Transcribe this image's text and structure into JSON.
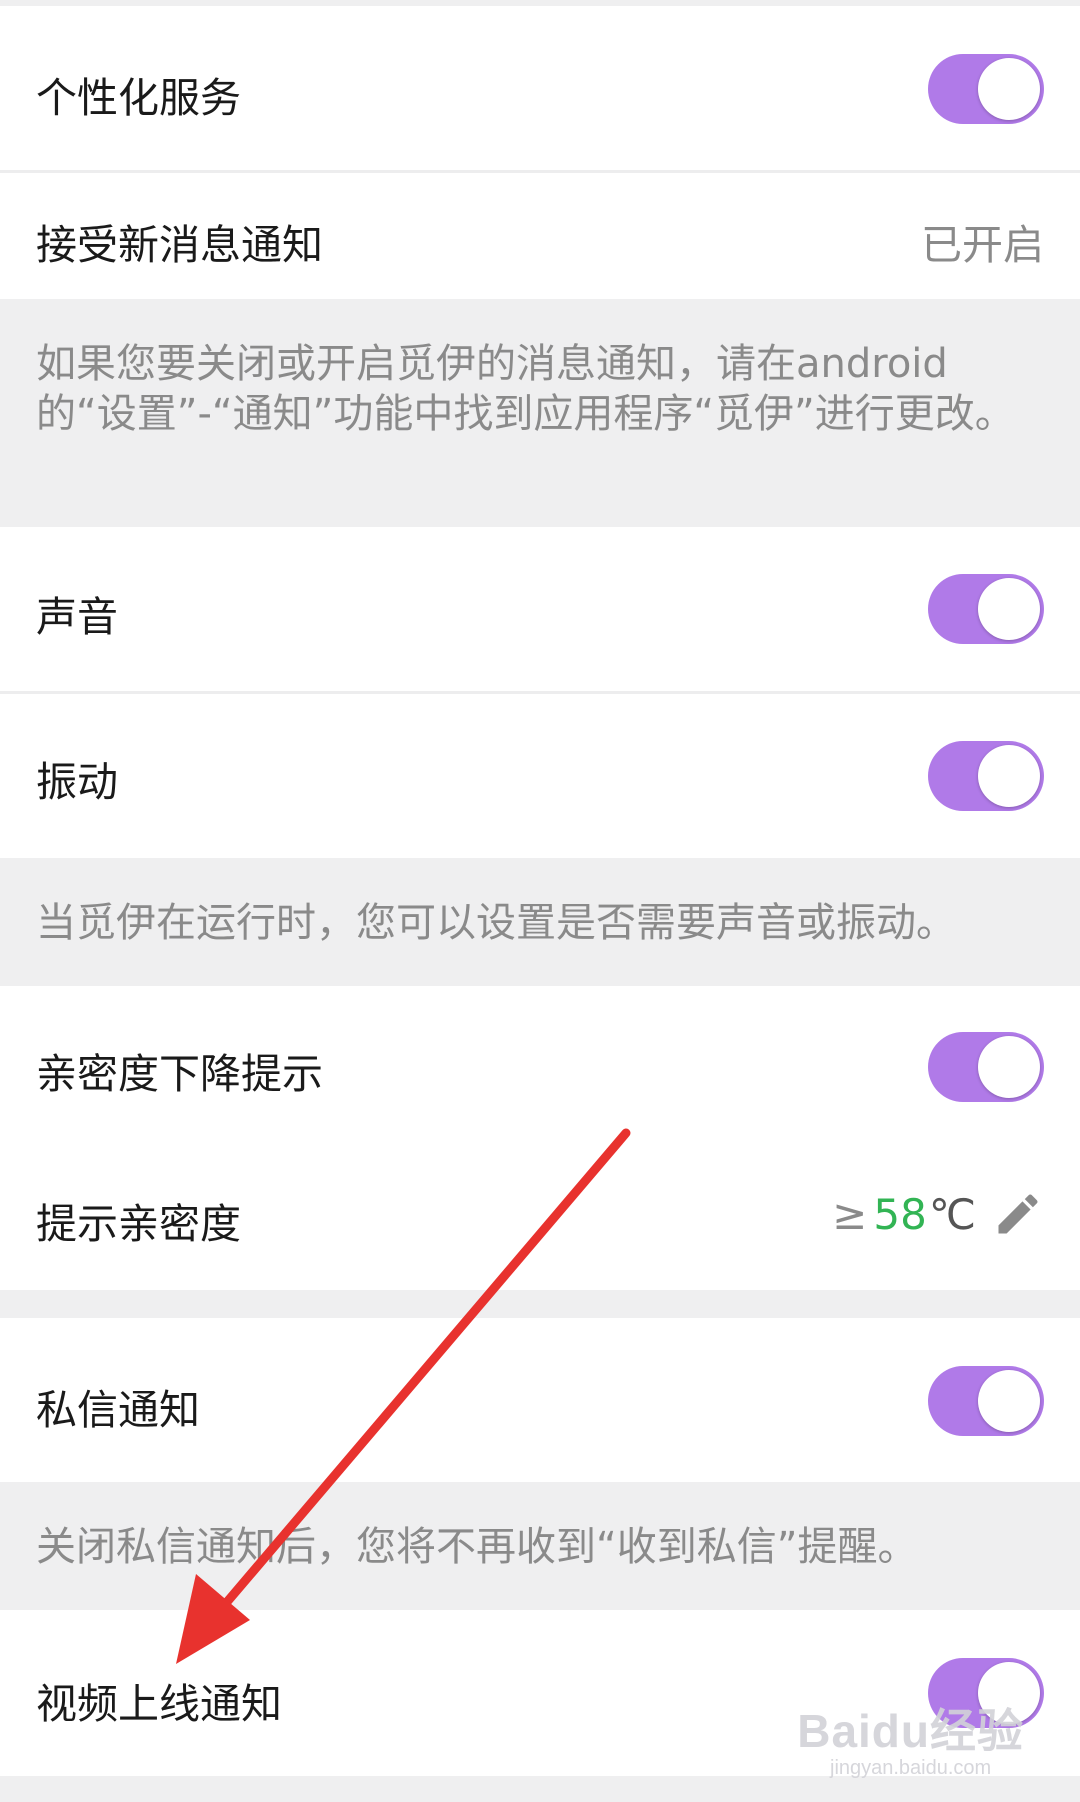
{
  "settings": {
    "personalized": {
      "label": "个性化服务",
      "enabled": true
    },
    "new_message_notice": {
      "label": "接受新消息通知",
      "value": "已开启"
    },
    "note_android": "如果您要关闭或开启觅伊的消息通知，请在android的“设置”-“通知”功能中找到应用程序“觅伊”进行更改。",
    "sound": {
      "label": "声音",
      "enabled": true
    },
    "vibration": {
      "label": "振动",
      "enabled": true
    },
    "note_sound": "当觅伊在运行时，您可以设置是否需要声音或振动。",
    "intimacy_drop": {
      "label": "亲密度下降提示",
      "enabled": true
    },
    "intimacy_threshold": {
      "label": "提示亲密度",
      "prefix": "≥",
      "number": "58",
      "unit": "℃"
    },
    "private_message": {
      "label": "私信通知",
      "enabled": true
    },
    "note_private": "关闭私信通知后，您将不再收到“收到私信”提醒。",
    "video_online": {
      "label": "视频上线通知",
      "enabled": true
    }
  },
  "colors": {
    "toggle_on": "#b07ae8",
    "affinity_number": "#32b454",
    "annotation_arrow": "#e8322e"
  },
  "icons": {
    "edit": "pencil-icon"
  },
  "watermark": {
    "brand": "Baidu经验",
    "url": "jingyan.baidu.com"
  }
}
